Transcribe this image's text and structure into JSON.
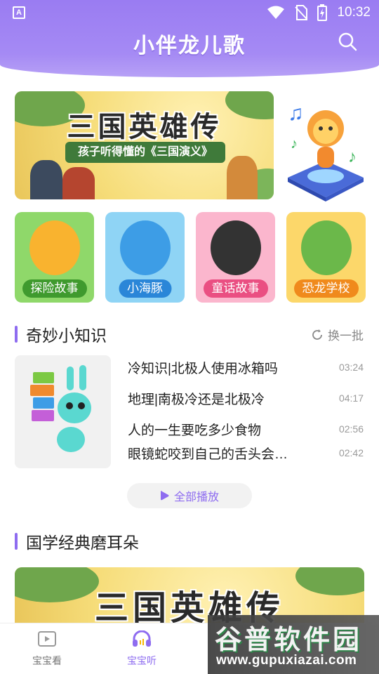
{
  "status_bar": {
    "left_badge": "A",
    "time": "10:32"
  },
  "header": {
    "title": "小伴龙儿歌",
    "search_icon": "search-icon"
  },
  "banner": {
    "title": "三国英雄传",
    "subtitle": "孩子听得懂的《三国演义》"
  },
  "categories": [
    {
      "label": "探险故事",
      "bg": "#8fd86a",
      "pill": "#3f9a2e"
    },
    {
      "label": "小海豚",
      "bg": "#8fd4f5",
      "pill": "#2a86d8"
    },
    {
      "label": "童话故事",
      "bg": "#fbb6cd",
      "pill": "#ea4f82"
    },
    {
      "label": "恐龙学校",
      "bg": "#fcd76a",
      "pill": "#f08a1c"
    }
  ],
  "knowledge": {
    "title": "奇妙小知识",
    "refresh_label": "换一批",
    "items": [
      {
        "title": "冷知识|北极人使用冰箱吗",
        "duration": "03:24"
      },
      {
        "title": "地理|南极冷还是北极冷",
        "duration": "04:17"
      },
      {
        "title": "人的一生要吃多少食物",
        "duration": "02:56"
      },
      {
        "title": "眼镜蛇咬到自己的舌头会中毒吗",
        "duration": "02:42"
      }
    ],
    "play_all_label": "全部播放"
  },
  "classics": {
    "title": "国学经典磨耳朵",
    "banner_title": "三国英雄传"
  },
  "bottom_nav": [
    {
      "label": "宝宝看",
      "icon": "video-icon",
      "active": false
    },
    {
      "label": "宝宝听",
      "icon": "headphones-icon",
      "active": true
    }
  ],
  "watermark": {
    "text": "谷普软件园",
    "url": "www.gupuxiazai.com"
  },
  "colors": {
    "accent": "#8e6cf0",
    "header": "#9a7cf2"
  }
}
